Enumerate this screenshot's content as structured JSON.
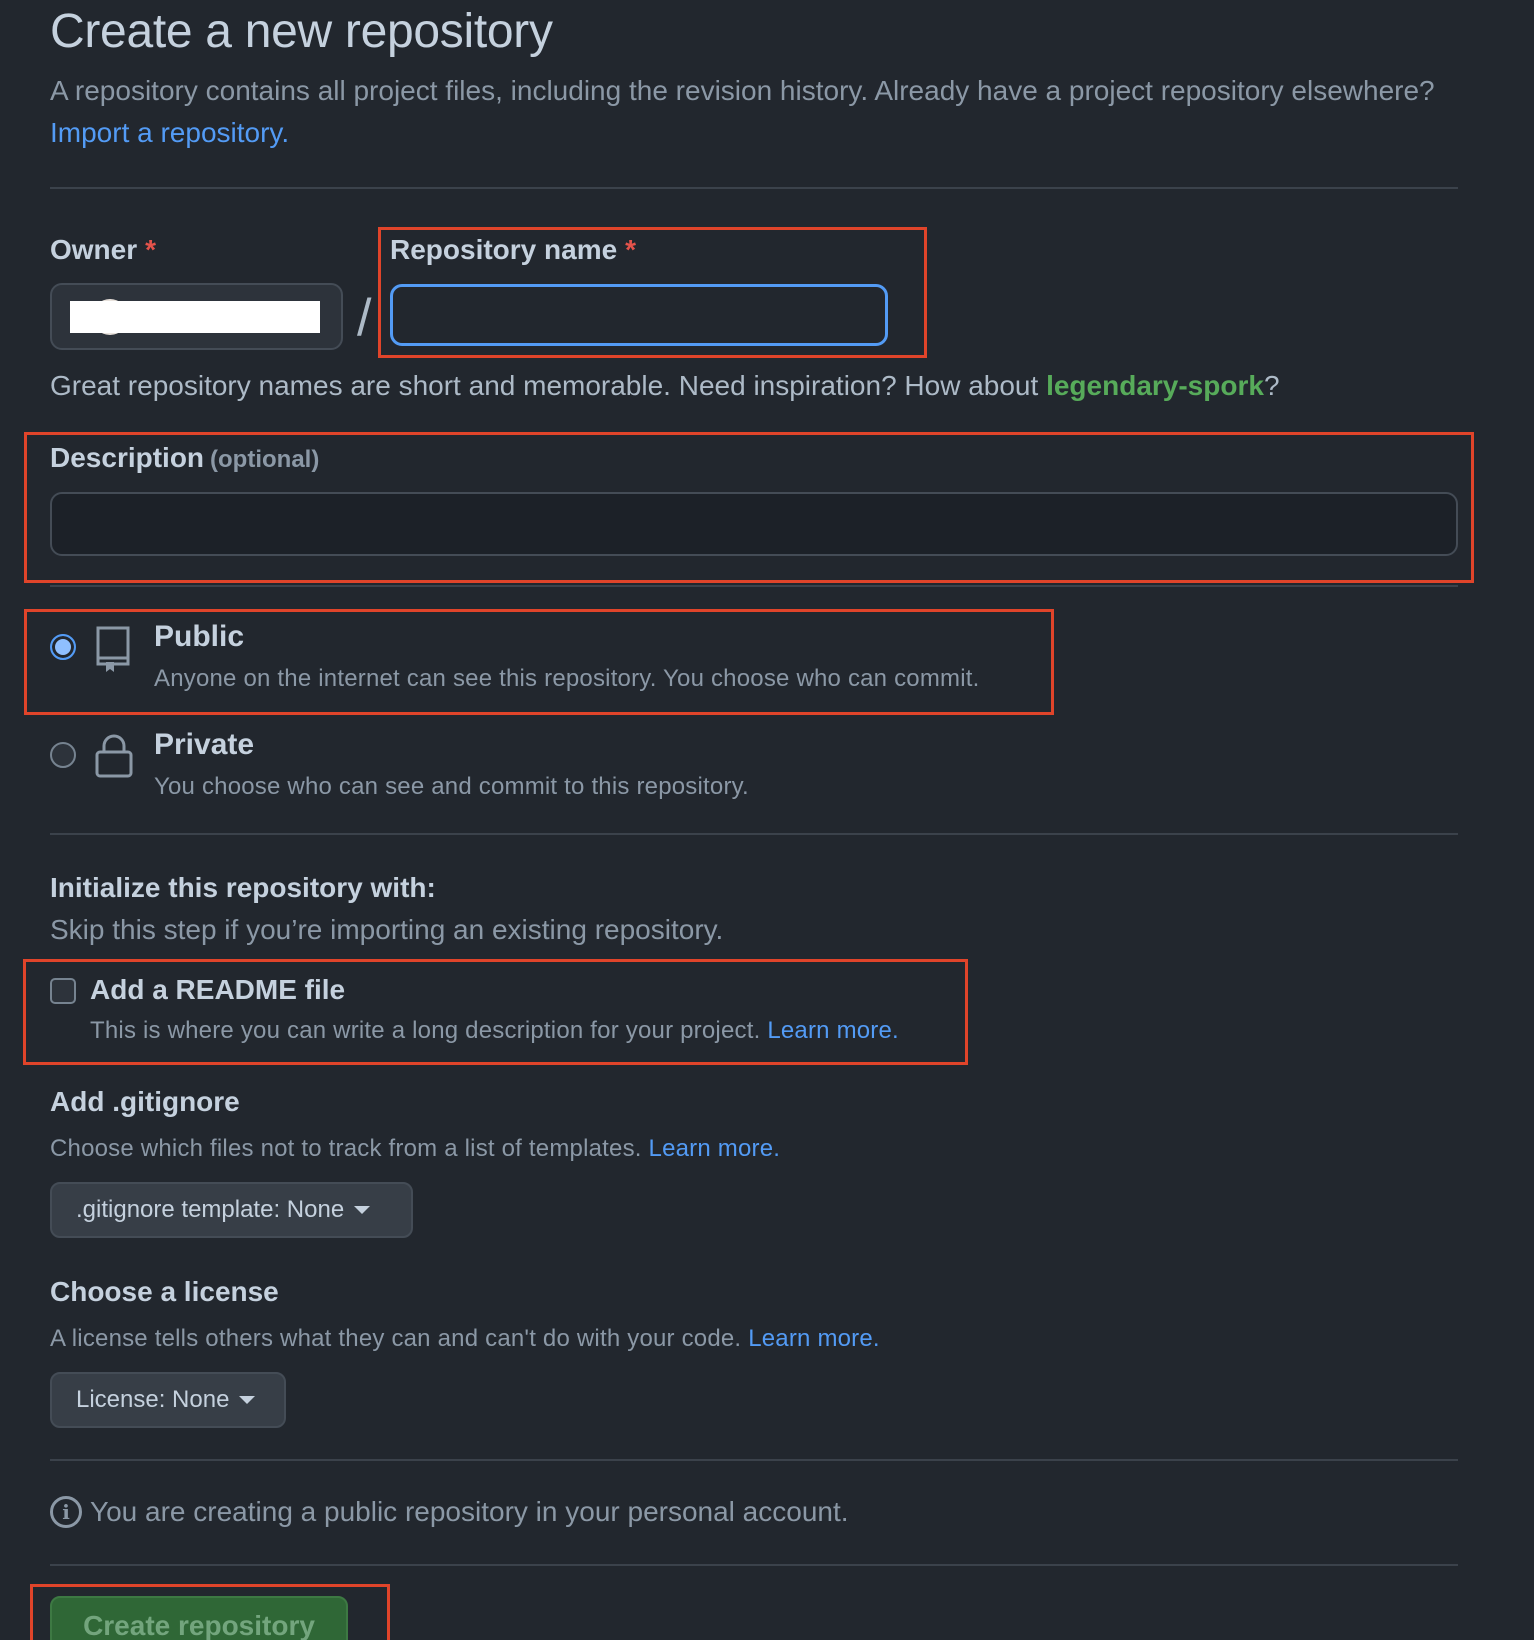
{
  "header": {
    "title": "Create a new repository",
    "intro_text": "A repository contains all project files, including the revision history. Already have a project repository elsewhere?",
    "import_link": "Import a repository."
  },
  "owner": {
    "label": "Owner",
    "required_mark": "*"
  },
  "repo_name": {
    "label": "Repository name",
    "required_mark": "*",
    "value": "",
    "slash": "/"
  },
  "name_hint": {
    "text": "Great repository names are short and memorable. Need inspiration? How about",
    "suggestion": "legendary-spork",
    "suffix": "?"
  },
  "description": {
    "label": "Description",
    "optional": "(optional)",
    "value": ""
  },
  "visibility": {
    "selected": "public",
    "public_title": "Public",
    "public_desc": "Anyone on the internet can see this repository. You choose who can commit.",
    "private_title": "Private",
    "private_desc": "You choose who can see and commit to this repository."
  },
  "init": {
    "heading": "Initialize this repository with:",
    "sub": "Skip this step if you’re importing an existing repository.",
    "readme_title": "Add a README file",
    "readme_desc": "This is where you can write a long description for your project.",
    "readme_link": "Learn more.",
    "readme_checked": false
  },
  "gitignore": {
    "heading": "Add .gitignore",
    "desc": "Choose which files not to track from a list of templates.",
    "link": "Learn more.",
    "dropdown_label": ".gitignore template: None"
  },
  "license": {
    "heading": "Choose a license",
    "desc": "A license tells others what they can and can't do with your code.",
    "link": "Learn more.",
    "dropdown_label": "License: None"
  },
  "notice": {
    "icon": "info-icon",
    "text": "You are creating a public repository in your personal account."
  },
  "submit": {
    "label": "Create repository"
  },
  "colors": {
    "background": "#22272e",
    "accent": "#539bf5",
    "highlight_box": "#e0442a",
    "suggestion_green": "#57ab5a",
    "button_green": "#347d39"
  }
}
